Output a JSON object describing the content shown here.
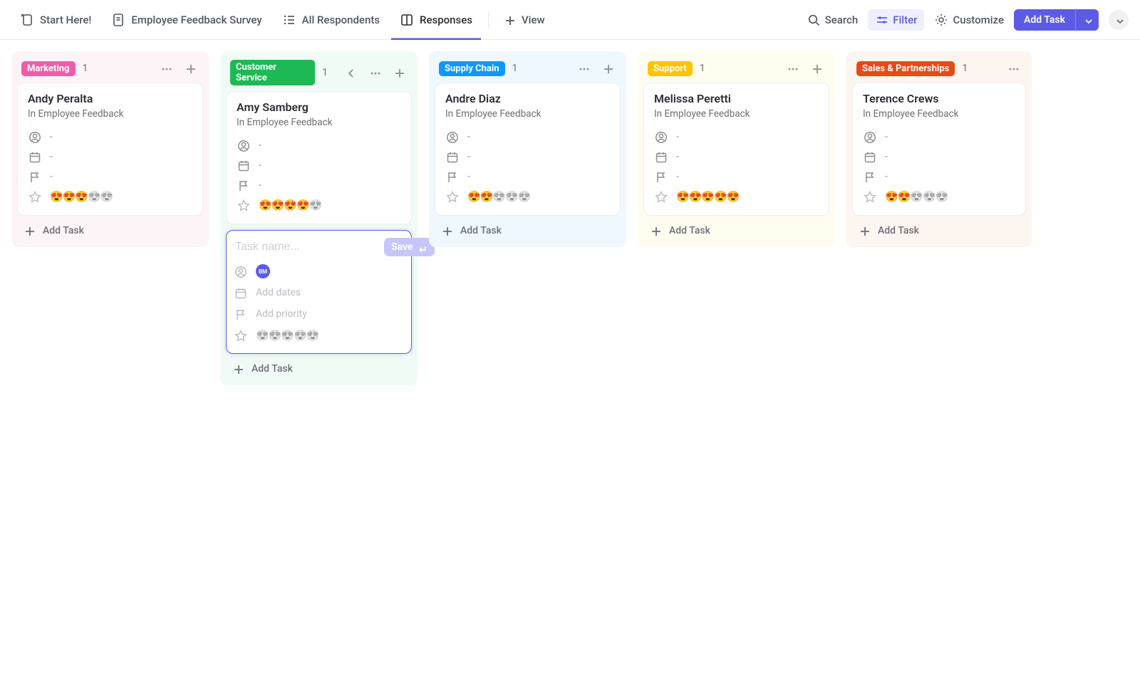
{
  "toolbar": {
    "tabs": [
      {
        "label": "Start Here!",
        "icon": "doc-arrow-icon"
      },
      {
        "label": "Employee Feedback Survey",
        "icon": "doc-icon"
      },
      {
        "label": "All Respondents",
        "icon": "list-icon"
      },
      {
        "label": "Responses",
        "icon": "board-icon",
        "active": true
      }
    ],
    "view_label": "View",
    "search_label": "Search",
    "filter_label": "Filter",
    "customize_label": "Customize",
    "add_task_label": "Add Task"
  },
  "columns": [
    {
      "key": "marketing",
      "label": "Marketing",
      "count": "1",
      "color": "#ef5da8",
      "bg": "marketing",
      "focus": false
    },
    {
      "key": "customer",
      "label": "Customer Service",
      "count": "1",
      "color": "#1db954",
      "bg": "customer",
      "focus": true
    },
    {
      "key": "supply",
      "label": "Supply Chain",
      "count": "1",
      "color": "#0f97ff",
      "bg": "supply",
      "focus": false
    },
    {
      "key": "support",
      "label": "Support",
      "count": "1",
      "color": "#ffc400",
      "bg": "support",
      "focus": false
    },
    {
      "key": "sales",
      "label": "Sales & Partnerships",
      "count": "1",
      "color": "#e64a19",
      "bg": "sales",
      "focus": false
    }
  ],
  "cards": {
    "marketing": {
      "name": "Andy Peralta",
      "sub": "In Employee Feedback",
      "rating": 3
    },
    "customer": {
      "name": "Amy Samberg",
      "sub": "In Employee Feedback",
      "rating": 4
    },
    "supply": {
      "name": "Andre Diaz",
      "sub": "In Employee Feedback",
      "rating": 2
    },
    "support": {
      "name": "Melissa Peretti",
      "sub": "In Employee Feedback",
      "rating": 5
    },
    "sales": {
      "name": "Terence Crews",
      "sub": "In Employee Feedback",
      "rating": 2
    }
  },
  "compose": {
    "placeholder": "Task name...",
    "save_label": "Save",
    "add_dates": "Add dates",
    "add_priority": "Add priority",
    "avatar": "BM"
  },
  "add_task_label": "Add Task",
  "dash": "-"
}
